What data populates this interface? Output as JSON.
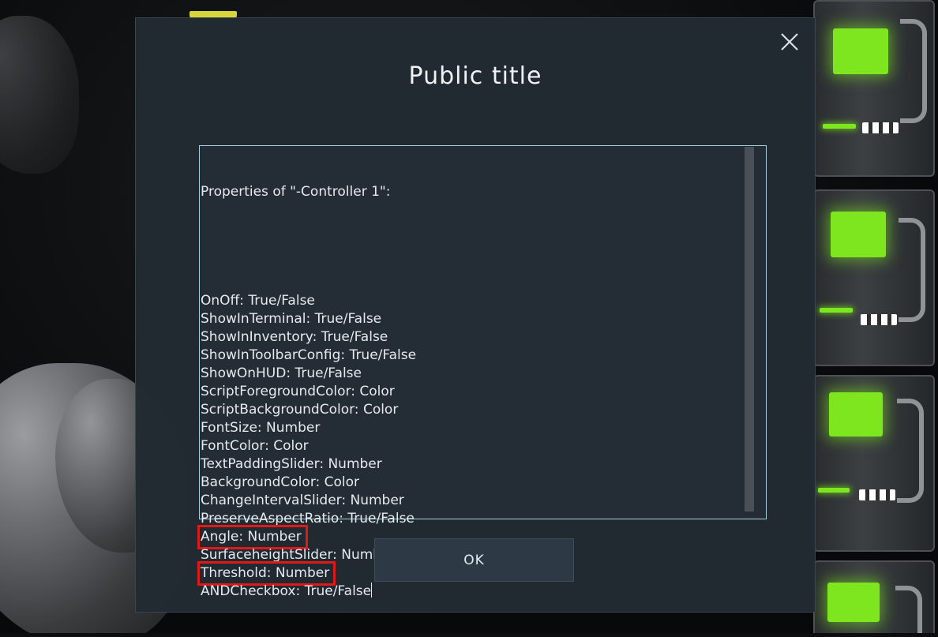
{
  "dialog": {
    "title": "Public title",
    "close_icon": "close-icon",
    "ok_label": "OK",
    "text": {
      "header": "Properties of \"-Controller 1\":",
      "properties": [
        {
          "text": "OnOff: True/False",
          "highlighted": false
        },
        {
          "text": "ShowInTerminal: True/False",
          "highlighted": false
        },
        {
          "text": "ShowInInventory: True/False",
          "highlighted": false
        },
        {
          "text": "ShowInToolbarConfig: True/False",
          "highlighted": false
        },
        {
          "text": "ShowOnHUD: True/False",
          "highlighted": false
        },
        {
          "text": "ScriptForegroundColor: Color",
          "highlighted": false
        },
        {
          "text": "ScriptBackgroundColor: Color",
          "highlighted": false
        },
        {
          "text": "FontSize: Number",
          "highlighted": false
        },
        {
          "text": "FontColor: Color",
          "highlighted": false
        },
        {
          "text": "TextPaddingSlider: Number",
          "highlighted": false
        },
        {
          "text": "BackgroundColor: Color",
          "highlighted": false
        },
        {
          "text": "ChangeIntervalSlider: Number",
          "highlighted": false
        },
        {
          "text": "PreserveAspectRatio: True/False",
          "highlighted": false
        },
        {
          "text": "Angle: Number",
          "highlighted": true
        },
        {
          "text": "SurfaceheightSlider: Number",
          "highlighted": false
        },
        {
          "text": "Threshold: Number",
          "highlighted": true
        },
        {
          "text": "ANDCheckbox: True/False",
          "highlighted": false
        }
      ]
    }
  },
  "colors": {
    "dialog_background": "#222a32",
    "text_area_border": "#a9cfe2",
    "highlight_box": "#e01818",
    "screen_green": "#7ee61e"
  }
}
